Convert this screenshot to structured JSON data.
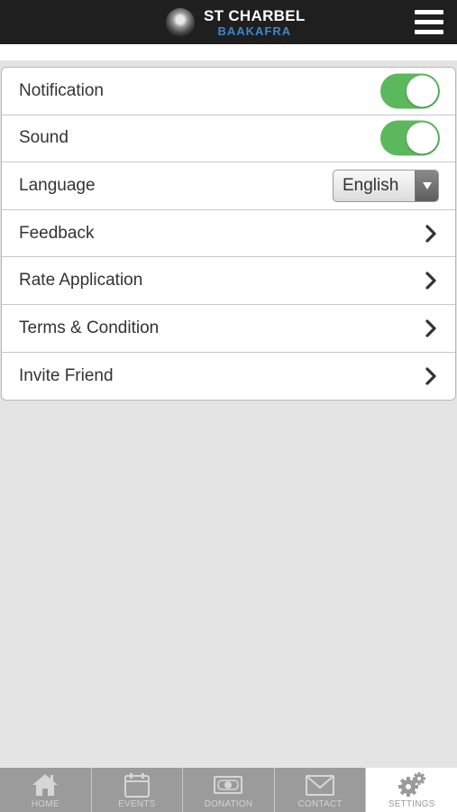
{
  "header": {
    "title": "ST CHARBEL",
    "subtitle": "BAAKAFRA",
    "menu_icon": "hamburger-menu-icon"
  },
  "settings": {
    "notification": {
      "label": "Notification",
      "enabled": true
    },
    "sound": {
      "label": "Sound",
      "enabled": true
    },
    "language": {
      "label": "Language",
      "value": "English"
    },
    "feedback": {
      "label": "Feedback"
    },
    "rate": {
      "label": "Rate Application"
    },
    "terms": {
      "label": "Terms & Condition"
    },
    "invite": {
      "label": "Invite Friend"
    }
  },
  "tabs": [
    {
      "label": "HOME",
      "icon": "home-icon"
    },
    {
      "label": "EVENTS",
      "icon": "calendar-icon"
    },
    {
      "label": "DONATION",
      "icon": "money-icon"
    },
    {
      "label": "CONTACT",
      "icon": "envelope-icon"
    },
    {
      "label": "SETTINGS",
      "icon": "gears-icon",
      "active": true
    }
  ],
  "colors": {
    "header_bg": "#1f1f1f",
    "brand_blue": "#3f86c9",
    "toggle_on": "#5cb85c",
    "tabbar_bg": "#9b9b9b",
    "page_bg": "#e4e4e4"
  }
}
